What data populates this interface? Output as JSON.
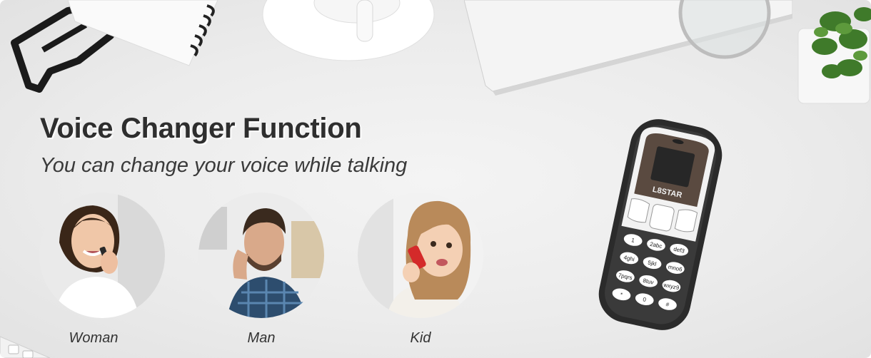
{
  "banner": {
    "title": "Voice Changer Function",
    "subtitle": "You can change your voice while talking"
  },
  "modes": [
    {
      "label": "Woman"
    },
    {
      "label": "Man"
    },
    {
      "label": "Kid"
    }
  ],
  "phone": {
    "brand": "L8STAR",
    "keys": [
      {
        "label": "1"
      },
      {
        "label": "2abc"
      },
      {
        "label": "def3"
      },
      {
        "label": "4ghi"
      },
      {
        "label": "5jkl"
      },
      {
        "label": "mno6"
      },
      {
        "label": "7pqrs"
      },
      {
        "label": "8tuv"
      },
      {
        "label": "wxyz9"
      },
      {
        "label": "*"
      },
      {
        "label": "0"
      },
      {
        "label": "#"
      }
    ]
  },
  "colors": {
    "background": "#ececec",
    "title": "#2e2e2e",
    "phone_body": "#2b2b2b",
    "phone_face": "#f2f2f2"
  }
}
